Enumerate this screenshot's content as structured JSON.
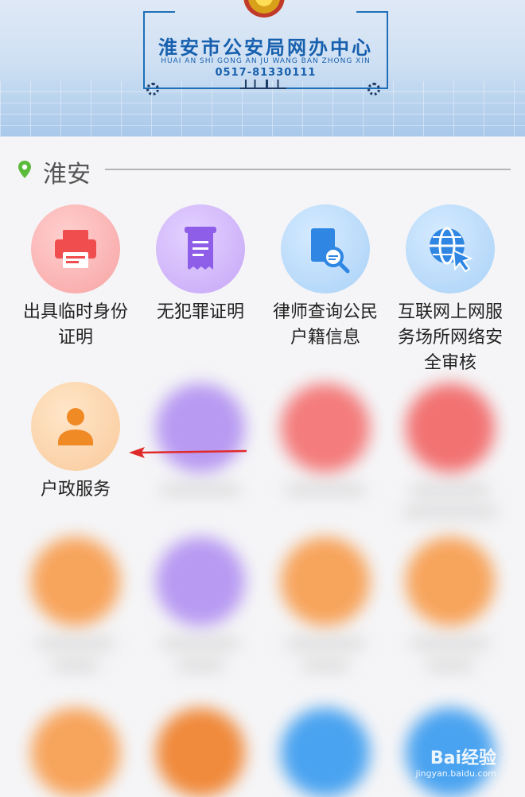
{
  "banner": {
    "title": "淮安市公安局网办中心",
    "subtitle": "HUAI AN SHI GONG AN JU WANG BAN ZHONG XIN",
    "phone": "0517-81330111"
  },
  "location": {
    "city": "淮安",
    "icon": "location-pin-icon",
    "icon_color": "#5dbb3c"
  },
  "services": [
    {
      "label": "出具临时身份证明",
      "icon": "printer-icon",
      "color": "#f26b6b"
    },
    {
      "label": "无犯罪证明",
      "icon": "receipt-icon",
      "color": "#9a6cf0"
    },
    {
      "label": "律师查询公民户籍信息",
      "icon": "document-search-icon",
      "color": "#3b8de8"
    },
    {
      "label": "互联网上网服务场所网络安全审核",
      "icon": "globe-cursor-icon",
      "color": "#3b8de8"
    },
    {
      "label": "户政服务",
      "icon": "person-icon",
      "color": "#f59a3c"
    }
  ],
  "watermark": {
    "brand": "Bai经验",
    "url": "jingyan.baidu.com"
  },
  "colors": {
    "accent_blue": "#1760ae",
    "arrow_red": "#e02a2a"
  }
}
